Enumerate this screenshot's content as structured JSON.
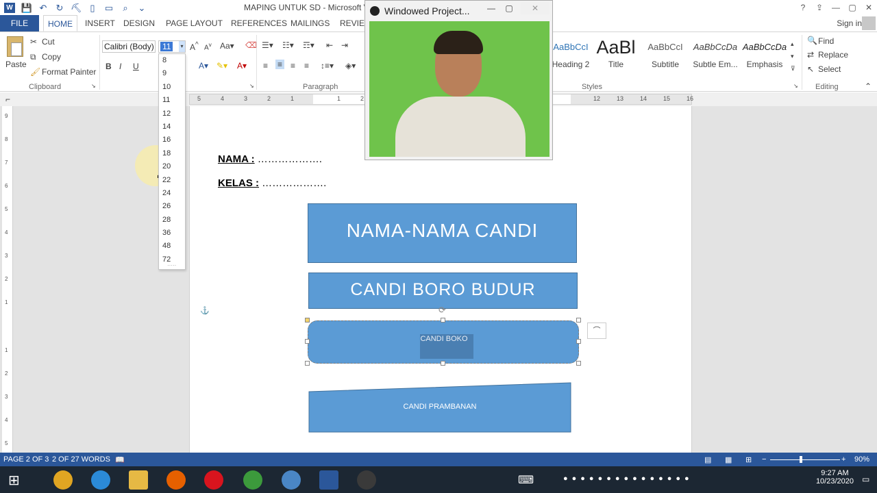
{
  "window": {
    "title": "MAPING UNTUK SD - Microsoft V",
    "help_icon": "?",
    "minimize": "—",
    "restore": "▢",
    "close": "✕"
  },
  "tabs": {
    "file": "FILE",
    "items": [
      "HOME",
      "INSERT",
      "DESIGN",
      "PAGE LAYOUT",
      "REFERENCES",
      "MAILINGS",
      "REVIEW"
    ],
    "sign_in": "Sign in"
  },
  "ribbon": {
    "clipboard": {
      "paste": "Paste",
      "cut": "Cut",
      "copy": "Copy",
      "format_painter": "Format Painter",
      "label": "Clipboard"
    },
    "font": {
      "family": "Calibri (Body)",
      "size": "11"
    },
    "paragraph": {
      "label": "Paragraph"
    },
    "styles": {
      "label": "Styles",
      "items": [
        {
          "sample": "AaBbCcI",
          "name": "Heading 2"
        },
        {
          "sample": "AaBl",
          "name": "Title"
        },
        {
          "sample": "AaBbCcI",
          "name": "Subtitle"
        },
        {
          "sample": "AaBbCcDa",
          "name": "Subtle Em..."
        },
        {
          "sample": "AaBbCcDa",
          "name": "Emphasis"
        }
      ]
    },
    "editing": {
      "label": "Editing",
      "find": "Find",
      "replace": "Replace",
      "select": "Select"
    }
  },
  "font_size_dropdown": [
    "8",
    "9",
    "10",
    "11",
    "12",
    "14",
    "16",
    "18",
    "20",
    "22",
    "24",
    "26",
    "28",
    "36",
    "48",
    "72"
  ],
  "ruler": {
    "numbers_left": [
      "5",
      "4",
      "3",
      "2",
      "1"
    ],
    "numbers_right": [
      "1",
      "2",
      "12",
      "13",
      "14",
      "15",
      "16"
    ],
    "vertical": [
      "9",
      "8",
      "7",
      "6",
      "5",
      "4",
      "3",
      "2",
      "1",
      "1",
      "2",
      "3",
      "4",
      "5"
    ]
  },
  "document": {
    "nama_label": "NAMA :",
    "nama_dots": " ……………….",
    "kelas_label": "KELAS :",
    "kelas_dots": " ……………….",
    "shapes": {
      "title": "NAMA-NAMA CANDI",
      "borobudur": "CANDI BORO BUDUR",
      "boko": "CANDI BOKO",
      "prambanan": "CANDI PRAMBANAN"
    }
  },
  "webcam": {
    "title": "Windowed Project..."
  },
  "status": {
    "page": "PAGE 2 OF 3",
    "words": "2 OF 27 WORDS",
    "zoom": "90%"
  },
  "taskbar": {
    "time": "9:27 AM",
    "date": "10/23/2020"
  },
  "colors": {
    "word_blue": "#2b579a",
    "shape_fill": "#5b9bd5",
    "webcam_green": "#6fc34b",
    "taskbar": "#1c2733"
  }
}
